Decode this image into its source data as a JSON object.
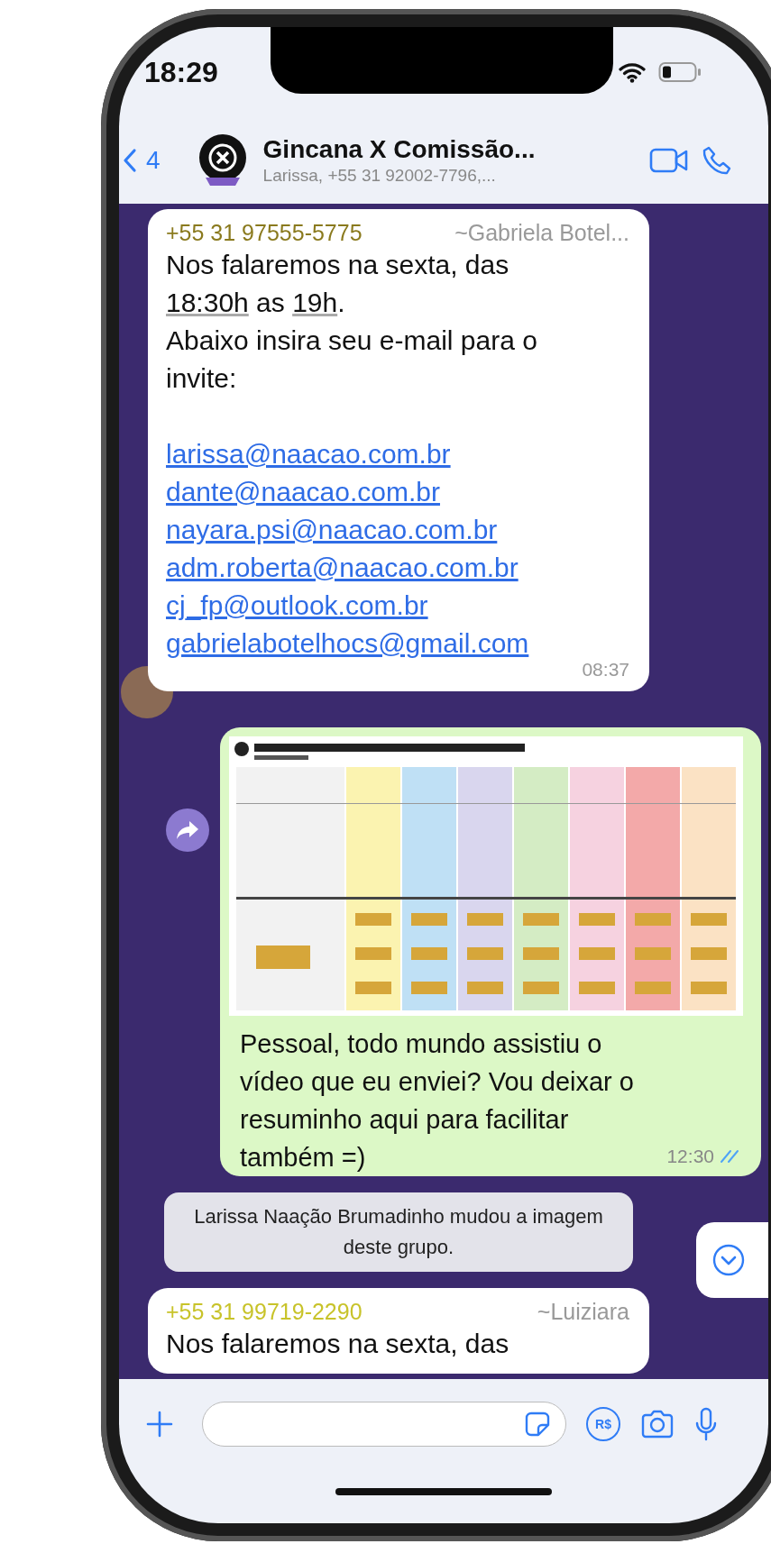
{
  "status_bar": {
    "time": "18:29"
  },
  "header": {
    "back_count": "4",
    "title": "Gincana X Comissão...",
    "subtitle": "Larissa, +55 31 92002-7796,..."
  },
  "messages": [
    {
      "kind": "incoming",
      "avatar": true,
      "sender_phone": "+55 31 97555-5775",
      "sender_name": "~Gabriela Botel...",
      "color": "#8a7a1e",
      "paragraphs": [
        [
          {
            "text": "Nos falaremos na sexta, das",
            "underlined": false
          }
        ],
        [
          {
            "text": "18:30h",
            "underlined": true
          },
          {
            "text": " as ",
            "underlined": false
          },
          {
            "text": "19h",
            "underlined": true
          },
          {
            "text": ".",
            "underlined": false
          }
        ],
        [
          {
            "text": "Abaixo insira seu e-mail para o invite:",
            "underlined": false
          }
        ]
      ],
      "links": [
        "larissa@naacao.com.br",
        "dante@naacao.com.br",
        "nayara.psi@naacao.com.br",
        "adm.roberta@naacao.com.br",
        "cj_fp@outlook.com.br",
        "gabrielabotelhocs@gmail.com"
      ],
      "time": "08:37"
    },
    {
      "kind": "outgoing",
      "text": "Pessoal, todo mundo assistiu o vídeo que eu enviei? Vou deixar o resuminho aqui para facilitar também =)",
      "time": "12:30",
      "read": true
    },
    {
      "kind": "system",
      "text": "Larissa Naação Brumadinho mudou a imagem deste grupo."
    },
    {
      "kind": "incoming",
      "avatar": false,
      "sender_phone": "+55 31 99719-2290",
      "sender_name": "~Luiziara",
      "color": "#c8c32a",
      "paragraphs": [
        [
          {
            "text": "Nos falaremos na sexta, das",
            "underlined": false
          }
        ]
      ]
    }
  ],
  "composer": {
    "payment_label": "R$"
  }
}
